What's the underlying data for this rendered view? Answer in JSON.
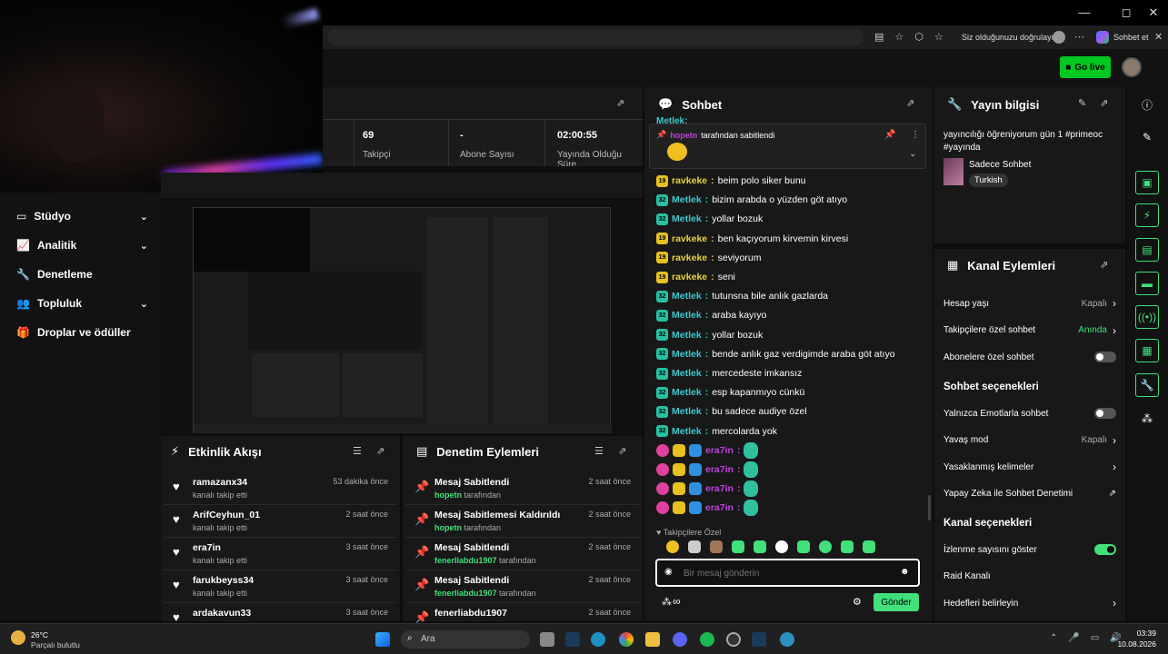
{
  "browser": {
    "verify_text": "Siz olduğunuzu doğrulayın",
    "chat_label": "Sohbet et",
    "min": "—",
    "max": "◻",
    "close": "✕"
  },
  "topbar": {
    "go_live": "Go live"
  },
  "stats": [
    {
      "value": "69",
      "label": "Takipçi"
    },
    {
      "value": "-",
      "label": "Abone Sayısı"
    },
    {
      "value": "02:00:55",
      "label": "Yayında Olduğu Süre"
    }
  ],
  "sidebar": {
    "items": [
      {
        "label": "Stüdyo",
        "chevron": true
      },
      {
        "label": "Analitik",
        "chevron": true
      },
      {
        "label": "Denetleme",
        "chevron": false
      },
      {
        "label": "Topluluk",
        "chevron": true
      },
      {
        "label": "Droplar ve ödüller",
        "chevron": false
      }
    ]
  },
  "activity": {
    "title": "Etkinlik Akışı",
    "rows": [
      {
        "name": "ramazanx34",
        "sub": "kanalı takip etti",
        "time": "53 dakika önce"
      },
      {
        "name": "ArifCeyhun_01",
        "sub": "kanalı takip etti",
        "time": "2 saat önce"
      },
      {
        "name": "era7in",
        "sub": "kanalı takip etti",
        "time": "3 saat önce"
      },
      {
        "name": "farukbeyss34",
        "sub": "kanalı takip etti",
        "time": "3 saat önce"
      },
      {
        "name": "ardakavun33",
        "sub": "",
        "time": "3 saat önce"
      }
    ]
  },
  "modlog": {
    "title": "Denetim Eylemleri",
    "rows": [
      {
        "name": "Mesaj Sabitlendi",
        "user": "hopetn",
        "suffix": "tarafından",
        "time": "2 saat önce"
      },
      {
        "name": "Mesaj Sabitlemesi Kaldırıldı",
        "user": "hopetn",
        "suffix": "tarafından",
        "time": "2 saat önce"
      },
      {
        "name": "Mesaj Sabitlendi",
        "user": "fenerliabdu1907",
        "suffix": "tarafından",
        "time": "2 saat önce"
      },
      {
        "name": "Mesaj Sabitlendi",
        "user": "fenerliabdu1907",
        "suffix": "tarafından",
        "time": "2 saat önce"
      },
      {
        "name": "fenerliabdu1907",
        "user": "",
        "suffix": "",
        "time": "2 saat önce"
      }
    ]
  },
  "chat": {
    "title": "Sohbet",
    "partial_top": "Metlek:",
    "pinned_user": "hopetn",
    "pinned_text": "tarafından sabitlendi",
    "messages": [
      {
        "badge": "19",
        "user": "ravkeke",
        "cls": "y",
        "text": "beim polo siker bunu"
      },
      {
        "badge": "32",
        "user": "Metlek",
        "cls": "c",
        "text": "bizim arabda o yüzden göt atıyo"
      },
      {
        "badge": "32",
        "user": "Metlek",
        "cls": "c",
        "text": "yollar bozuk"
      },
      {
        "badge": "19",
        "user": "ravkeke",
        "cls": "y",
        "text": "ben kaçıyorum kirvemin kirvesi"
      },
      {
        "badge": "19",
        "user": "ravkeke",
        "cls": "y",
        "text": "seviyorum"
      },
      {
        "badge": "19",
        "user": "ravkeke",
        "cls": "y",
        "text": "seni"
      },
      {
        "badge": "32",
        "user": "Metlek",
        "cls": "c",
        "text": "tutunsna bile anlık gazlarda"
      },
      {
        "badge": "32",
        "user": "Metlek",
        "cls": "c",
        "text": "araba kayıyo"
      },
      {
        "badge": "32",
        "user": "Metlek",
        "cls": "c",
        "text": "yollar bozuk"
      },
      {
        "badge": "32",
        "user": "Metlek",
        "cls": "c",
        "text": "bende anlık gaz verdigimde araba göt atıyo"
      },
      {
        "badge": "32",
        "user": "Metlek",
        "cls": "c",
        "text": "mercedeste imkansız"
      },
      {
        "badge": "32",
        "user": "Metlek",
        "cls": "c",
        "text": "esp kapanmıyo cünkü"
      },
      {
        "badge": "32",
        "user": "Metlek",
        "cls": "c",
        "text": "bu sadece audiye özel"
      },
      {
        "badge": "32",
        "user": "Metlek",
        "cls": "c",
        "text": "mercolarda yok"
      },
      {
        "badge": "",
        "user": "era7in",
        "cls": "m",
        "text": ""
      },
      {
        "badge": "",
        "user": "era7in",
        "cls": "m",
        "text": ""
      },
      {
        "badge": "",
        "user": "era7in",
        "cls": "m",
        "text": ""
      },
      {
        "badge": "",
        "user": "era7in",
        "cls": "m",
        "text": ""
      }
    ],
    "followers_only": "Takipçilere Özel",
    "placeholder": "Bir mesaj gönderin",
    "send": "Gönder"
  },
  "info": {
    "title": "Yayın bilgisi",
    "stream_title": "yayıncılığı öğreniyorum gün 1 #primeoc #yayında",
    "category": "Sadece Sohbet",
    "tag": "Turkish"
  },
  "actions": {
    "title": "Kanal Eylemleri",
    "rows": [
      {
        "label": "Hesap yaşı",
        "value": "Kapalı",
        "kind": "chev"
      },
      {
        "label": "Takipçilere özel sohbet",
        "value": "Anında",
        "kind": "chevg"
      },
      {
        "label": "Abonelere özel sohbet",
        "value": "",
        "kind": "toggle"
      }
    ],
    "chat_section": "Sohbet seçenekleri",
    "chat_rows": [
      {
        "label": "Yalnızca Emotlarla sohbet",
        "value": "",
        "kind": "toggle"
      },
      {
        "label": "Yavaş mod",
        "value": "Kapalı",
        "kind": "chev"
      },
      {
        "label": "Yasaklanmış kelimeler",
        "value": "",
        "kind": "chev"
      },
      {
        "label": "Yapay Zeka ile Sohbet Denetimi",
        "value": "",
        "kind": "ext"
      }
    ],
    "channel_section": "Kanal seçenekleri",
    "channel_rows": [
      {
        "label": "İzlenme sayısını göster",
        "value": "",
        "kind": "toggleon"
      },
      {
        "label": "Raid Kanalı",
        "value": "",
        "kind": "none"
      },
      {
        "label": "Hedefleri belirleyin",
        "value": "",
        "kind": "chev"
      }
    ]
  },
  "taskbar": {
    "temp": "26°C",
    "weather": "Parçalı bulutlu",
    "search": "Ara",
    "time": "03:39",
    "date": "10.08.2026"
  },
  "colors": {
    "accent": "#41e07a",
    "golive": "#00c820"
  }
}
